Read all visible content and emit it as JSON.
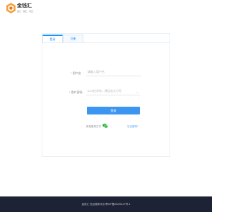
{
  "header": {
    "brand_name": "金钱汇",
    "slogan": "金汇 · 钱汇 · 利汇"
  },
  "login": {
    "tabs": [
      {
        "label": "登录",
        "active": true
      },
      {
        "label": "注册",
        "active": false
      }
    ],
    "account_label": "用户名",
    "account_placeholder": "请输入用户名",
    "password_label": "用户密码",
    "password_placeholder": "6-20位字符，建议含大小写",
    "submit_label": "登录",
    "other_login_label": "其他登录方式",
    "forgot_label": "忘记密码?"
  },
  "footer": {
    "text": "金钱汇·社区服务平台   鄂ICP备20200127号-1"
  },
  "colors": {
    "accent": "#3c95f0",
    "footer_bg": "#1d2235",
    "brand": "#e87722"
  },
  "icons": [
    "brand-logo-icon",
    "wechat-icon",
    "chevron-down-icon"
  ]
}
